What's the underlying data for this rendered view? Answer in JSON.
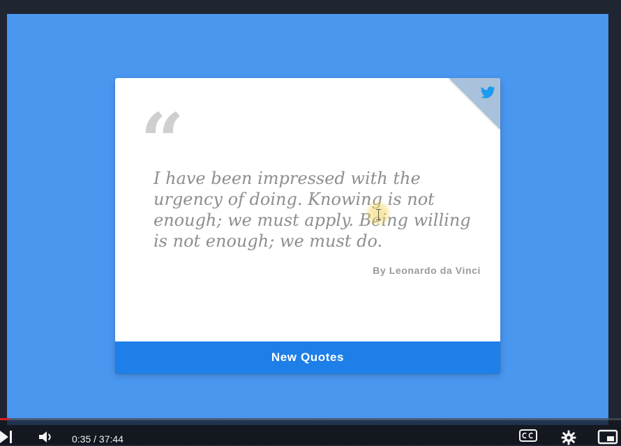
{
  "video": {
    "card": {
      "quote_mark": "“",
      "quote_text": "I have been impressed with the urgency of doing. Knowing is not enough; we must apply. Being willing is not enough; we must do.",
      "author": "By Leonardo da Vinci",
      "button_label": "New Quotes",
      "icons": {
        "twitter": "twitter-icon"
      }
    }
  },
  "player": {
    "time_display": "0:35 / 37:44",
    "progress": 0.0155,
    "icons": {
      "skip_next": "skip-next-icon",
      "volume": "volume-icon",
      "captions": "cc-icon",
      "settings": "gear-icon",
      "miniplayer": "miniplayer-icon"
    }
  },
  "colors": {
    "background": "#4a97f0",
    "button": "#1e7fe9",
    "corner": "#a9c1da",
    "progress": "#d81f26"
  }
}
